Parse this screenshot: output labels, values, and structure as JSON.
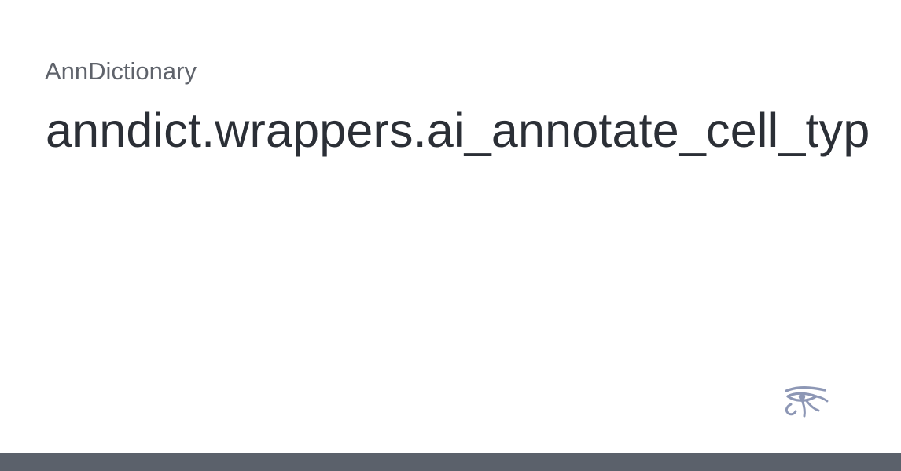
{
  "project": {
    "name": "AnnDictionary"
  },
  "page": {
    "title": "anndict.wrappers.ai_annotate_cell_typ"
  },
  "logo": {
    "icon": "eye-of-horus-icon",
    "color": "#8d97b5"
  },
  "footer": {
    "color": "#5b616b"
  }
}
